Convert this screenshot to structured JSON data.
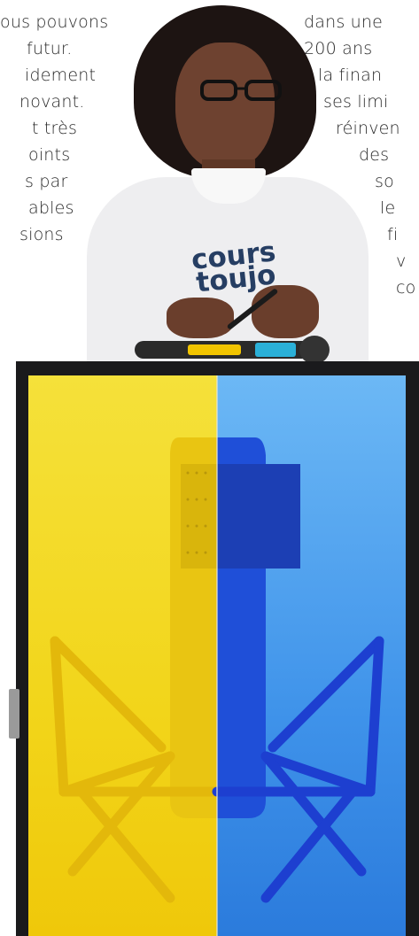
{
  "left_text": {
    "lines": [
      "ous pouvons",
      " futur.",
      "",
      "",
      "idement",
      "novant.",
      "t très",
      "oints",
      "s par",
      "ables",
      "sions"
    ]
  },
  "right_text": {
    "lines": [
      "dans une",
      "200 ans",
      "la finan",
      "ses limi",
      "réinven",
      "des",
      "so",
      "le",
      "fi",
      "v",
      "co"
    ]
  },
  "sweater_logo": {
    "line1": "cours",
    "line2": "toujo"
  },
  "colors": {
    "screen_left": "#f2d51a",
    "screen_right": "#3f93ea",
    "podium": "#1a1a1c",
    "logo": "#263e63"
  },
  "icons": {
    "microphone": "studio-microphone-icon"
  }
}
